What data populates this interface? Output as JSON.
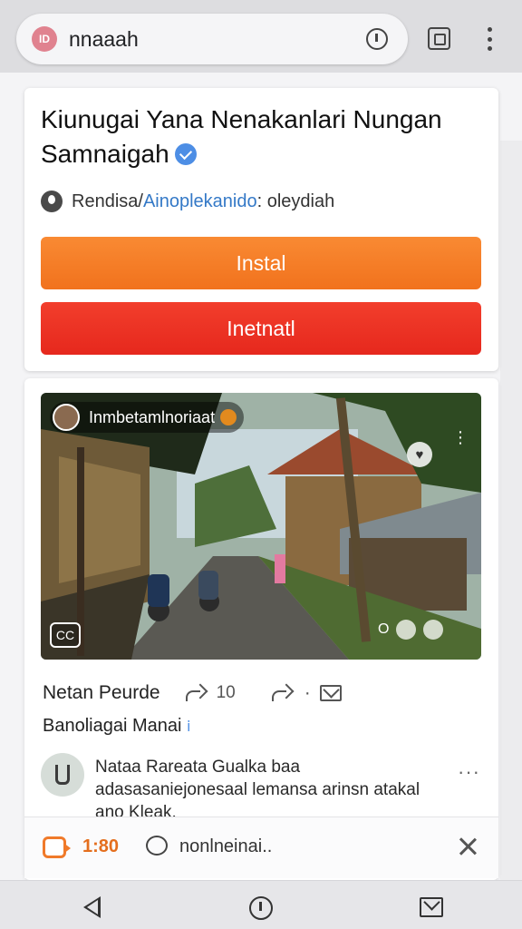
{
  "browser": {
    "site_icon_label": "ID",
    "url_text": "nnaaah"
  },
  "post": {
    "title": "Kiunugai Yana Nenakanlari Nungan Samnaigah",
    "meta_prefix": "Rendisa/",
    "meta_link": "Ainoplekanido",
    "meta_suffix": ": oleydiah",
    "install_label": "Instal",
    "install2_label": "Inetnatl"
  },
  "media": {
    "author_name": "Inmbetamlnoriaat",
    "heart_glyph": "♥",
    "more_glyph": "⋮",
    "cc_label": "CC",
    "controls_label": "O"
  },
  "actions": {
    "title": "Netan Peurde",
    "share_count": "10",
    "dot": "·",
    "subtitle": "Banoliagai Manai",
    "subtitle_mark": "ⅰ"
  },
  "comment": {
    "text": "Nataa Rareata Gualka baa adasasaniejonesaal lemansa arinsn atakal ano Kleak.",
    "more_glyph": "···"
  },
  "footer": {
    "count": "1:80",
    "label": "nonlneinai.."
  },
  "colors": {
    "accent_orange": "#f1721d",
    "accent_red": "#e6281d",
    "link_blue": "#3479c7",
    "verified_blue": "#4d8ee5"
  }
}
